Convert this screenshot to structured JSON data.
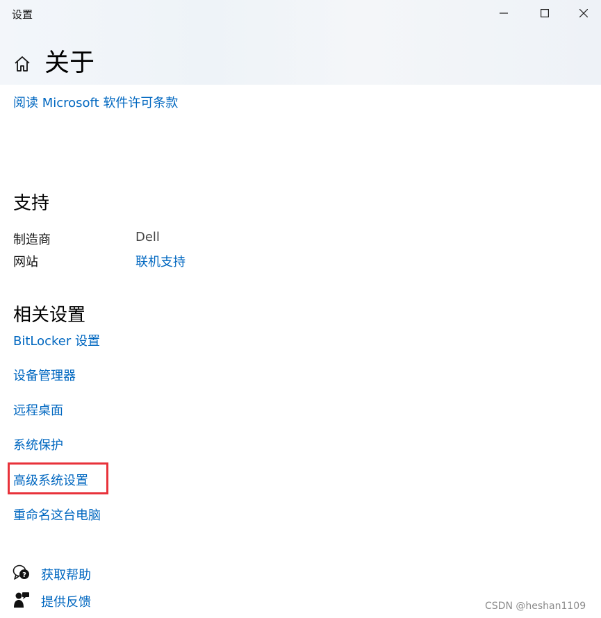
{
  "window": {
    "title": "设置",
    "controls": {
      "minimize": "minimize-icon",
      "maximize": "maximize-icon",
      "close": "close-icon"
    }
  },
  "header": {
    "page_title": "关于"
  },
  "license_link": "阅读 Microsoft 软件许可条款",
  "support": {
    "title": "支持",
    "rows": [
      {
        "label": "制造商",
        "value": "Dell"
      },
      {
        "label": "网站",
        "value": "联机支持"
      }
    ]
  },
  "related": {
    "title": "相关设置",
    "links": [
      "BitLocker 设置",
      "设备管理器",
      "远程桌面",
      "系统保护",
      "高级系统设置",
      "重命名这台电脑"
    ]
  },
  "footer": {
    "help": "获取帮助",
    "feedback": "提供反馈"
  },
  "watermark": "CSDN @heshan1109",
  "colors": {
    "link": "#0067c0",
    "highlight": "#e8323a",
    "header_bg": "#f1f5f9"
  }
}
